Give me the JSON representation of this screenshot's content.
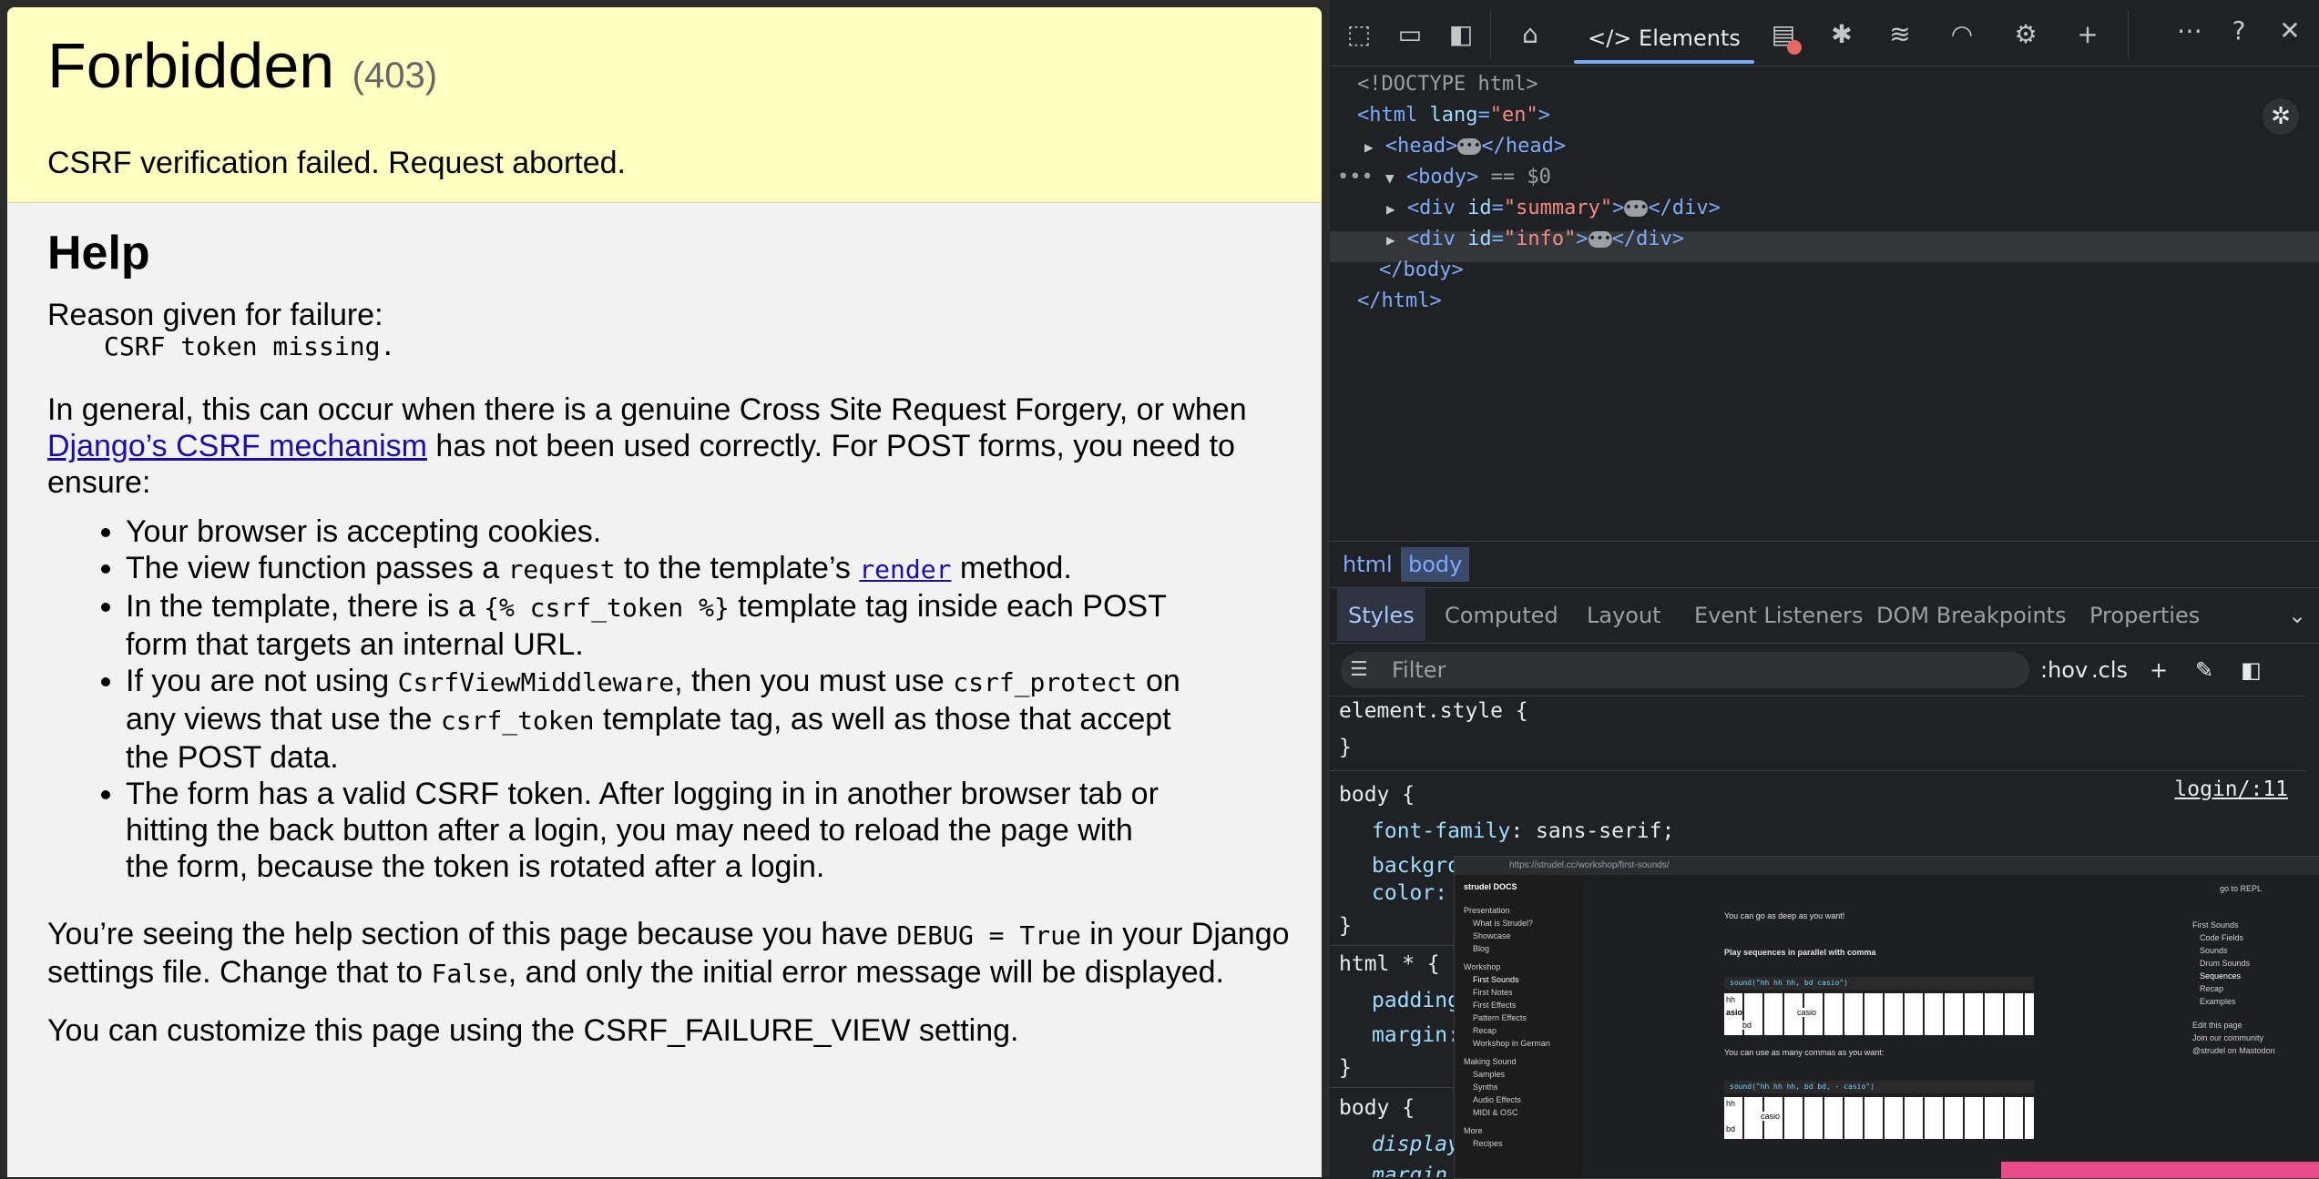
{
  "page": {
    "title": "Forbidden",
    "code": "(403)",
    "message": "CSRF verification failed. Request aborted.",
    "help_heading": "Help",
    "reason_label": "Reason given for failure:",
    "reason_code": "CSRF token missing.",
    "general_1": "In general, this can occur when there is a genuine Cross Site Request Forgery, or when ",
    "general_link": "Django’s CSRF mechanism",
    "general_2": " has not been used correctly. For POST forms, you need to ensure:",
    "bullets": {
      "b1": "Your browser is accepting cookies.",
      "b2a": "The view function passes a ",
      "b2code": "request",
      "b2b": " to the template’s ",
      "b2link": "render",
      "b2c": " method.",
      "b3a": "In the template, there is a ",
      "b3code": "{% csrf_token %}",
      "b3b": " template tag inside each POST form that targets an internal URL.",
      "b4a": "If you are not using ",
      "b4code1": "CsrfViewMiddleware",
      "b4b": ", then you must use ",
      "b4code2": "csrf_protect",
      "b4c": " on any views that use the ",
      "b4code3": "csrf_token",
      "b4d": " template tag, as well as those that accept the POST data.",
      "b5": "The form has a valid CSRF token. After logging in in another browser tab or hitting the back button after a login, you may need to reload the page with the form, because the token is rotated after a login."
    },
    "debug_1": "You’re seeing the help section of this page because you have ",
    "debug_code1": "DEBUG = True",
    "debug_2": " in your Django settings file. Change that to ",
    "debug_code2": "False",
    "debug_3": ", and only the initial error message will be displayed.",
    "customize": "You can customize this page using the CSRF_FAILURE_VIEW setting."
  },
  "devtools": {
    "elements_tab": "Elements",
    "icons": [
      "inspect-icon",
      "device-icon",
      "dock-icon",
      "home-icon",
      "console-icon",
      "bug-icon",
      "network-icon",
      "performance-icon",
      "settings-gear-icon",
      "plus-icon",
      "more-icon",
      "help-icon",
      "close-icon"
    ],
    "dom": {
      "doctype": "<!DOCTYPE html>",
      "html_open_tag": "<html",
      "html_attr": "lang",
      "html_val": "\"en\"",
      "head": "<head>",
      "head_close": "</head>",
      "body": "<body>",
      "body_eq": "== $0",
      "div": "<div",
      "id_attr": "id",
      "summary_val": "\"summary\"",
      "info_val": "\"info\"",
      "div_close": "</div>",
      "body_close": "</body>",
      "html_close": "</html>",
      "gt": ">"
    },
    "breadcrumbs": [
      "html",
      "body"
    ],
    "styles_tabs": [
      "Styles",
      "Computed",
      "Layout",
      "Event Listeners",
      "DOM Breakpoints",
      "Properties"
    ],
    "filter_placeholder": "Filter",
    "hov": ":hov",
    "cls": ".cls",
    "rules": {
      "element_style": "element.style {",
      "close": "}",
      "body_sel": "body {",
      "source": "login/:11",
      "font_prop": "font-family",
      "font_val": "sans-serif;",
      "bg_prop": "backgro",
      "color_prop": "color:",
      "html_star": "html * {",
      "padding_prop": "padding",
      "margin_prop": "margin:",
      "body_sel2": "body {",
      "display_prop": "display",
      "margin_prop2": "margin"
    }
  },
  "overlay": {
    "url": "https://strudel.cc/workshop/first-sounds/",
    "brand": "strudel DOCS",
    "side": [
      "Presentation",
      "What is Strudel?",
      "Showcase",
      "Blog",
      "Workshop",
      "First Sounds",
      "First Notes",
      "First Effects",
      "Pattern Effects",
      "Recap",
      "Workshop in German",
      "Making Sound",
      "Samples",
      "Synths",
      "Audio Effects",
      "MIDI & OSC",
      "More",
      "Recipes"
    ],
    "main": {
      "deep": "You can go as deep as you want!",
      "parallel": "Play sequences in parallel with comma",
      "code1": "sound(\"hh hh hh, bd casio\")",
      "commas": "You can use as many commas as you want:",
      "code2": "sound(\"hh hh hh, bd bd, - casio\")",
      "cell_hh": "hh",
      "cell_casio": "casio",
      "cell_bd": "bd",
      "cell_asio": "asio"
    },
    "right": [
      "First Sounds",
      "Code Fields",
      "Sounds",
      "Drum Sounds",
      "Sequences",
      "Recap",
      "Examples",
      "Edit this page",
      "Join our community",
      "@strudel on Mastodon"
    ],
    "goto": "go to REPL"
  }
}
